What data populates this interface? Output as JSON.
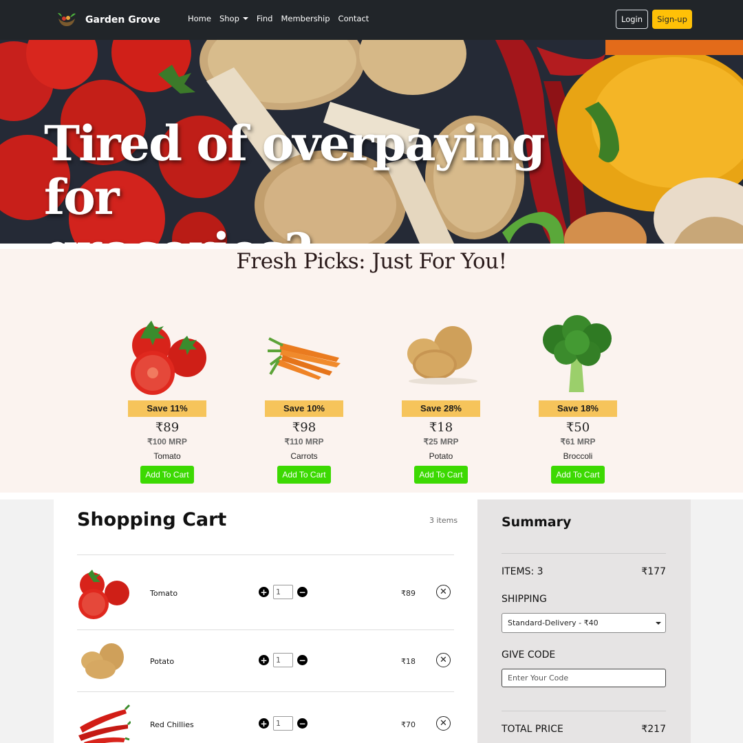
{
  "navbar": {
    "brand": "Garden Grove",
    "links": [
      "Home",
      "Shop",
      "Find",
      "Membership",
      "Contact"
    ],
    "login_label": "Login",
    "signup_label": "Sign-up"
  },
  "hero": {
    "title_line1": "Tired of overpaying for",
    "title_line2": "groceries?"
  },
  "picks": {
    "title": "Fresh Picks: Just For You!",
    "products": [
      {
        "name": "Tomato",
        "save": "Save 11%",
        "price": "₹89",
        "mrp": "₹100 MRP",
        "button": "Add To Cart"
      },
      {
        "name": "Carrots",
        "save": "Save 10%",
        "price": "₹98",
        "mrp": "₹110 MRP",
        "button": "Add To Cart"
      },
      {
        "name": "Potato",
        "save": "Save 28%",
        "price": "₹18",
        "mrp": "₹25 MRP",
        "button": "Add To Cart"
      },
      {
        "name": "Broccoli",
        "save": "Save 18%",
        "price": "₹50",
        "mrp": "₹61 MRP",
        "button": "Add To Cart"
      }
    ]
  },
  "cart": {
    "title": "Shopping Cart",
    "count": "3 items",
    "items": [
      {
        "name": "Tomato",
        "qty": "1",
        "price": "₹89"
      },
      {
        "name": "Potato",
        "qty": "1",
        "price": "₹18"
      },
      {
        "name": "Red Chillies",
        "qty": "1",
        "price": "₹70"
      }
    ]
  },
  "summary": {
    "title": "Summary",
    "items_label": "ITEMS: 3",
    "items_value": "₹177",
    "shipping_label": "SHIPPING",
    "shipping_option": "Standard-Delivery - ₹40",
    "code_label": "GIVE CODE",
    "code_placeholder": "Enter Your Code",
    "total_label": "TOTAL PRICE",
    "total_value": "₹217"
  },
  "colors": {
    "nav_bg": "#212529",
    "signup_bg": "#ffc107",
    "picks_bg": "#fbf3ef",
    "save_badge": "#f6c45b",
    "add_button": "#3cd902",
    "summary_bg": "#e6e4e4"
  }
}
